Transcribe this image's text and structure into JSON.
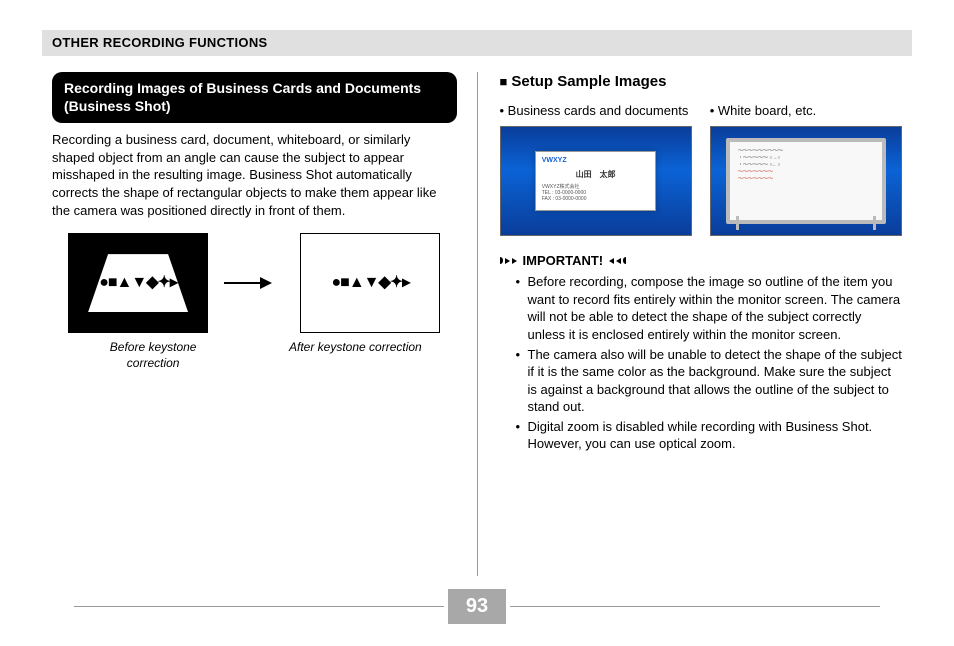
{
  "header": "OTHER RECORDING FUNCTIONS",
  "page_number": "93",
  "left": {
    "title": "Recording Images of Business Cards and Documents (Business Shot)",
    "paragraph": "Recording a business card, document, whiteboard, or similarly shaped object from an angle can cause the subject to appear misshaped in the resulting image. Business Shot automatically corrects the shape of rectangular objects to make them appear like the camera was positioned directly in front of them.",
    "caption_before": "Before keystone correction",
    "caption_after": "After keystone correction"
  },
  "right": {
    "section_title": "Setup Sample Images",
    "sample_a_label": "• Business cards and documents",
    "sample_b_label": "• White board, etc.",
    "card": {
      "logo": "VWXYZ",
      "name": "山田　太郎",
      "line1": "VWXYZ株式会社",
      "line2": "TEL : 03-0000-0000",
      "line3": "FAX : 03-0000-0000"
    },
    "important_label": "IMPORTANT!",
    "important_items": [
      "Before recording, compose the image so outline of the item you want to record fits entirely within the monitor screen. The camera will not be able to detect the shape of the subject correctly unless it is enclosed entirely within the monitor screen.",
      "The camera also will be unable to detect the shape of the subject if it is the same color as the background. Make sure the subject is against a background that allows the outline of the subject to stand out.",
      "Digital zoom is disabled while recording with Business Shot. However, you can use optical zoom."
    ]
  }
}
